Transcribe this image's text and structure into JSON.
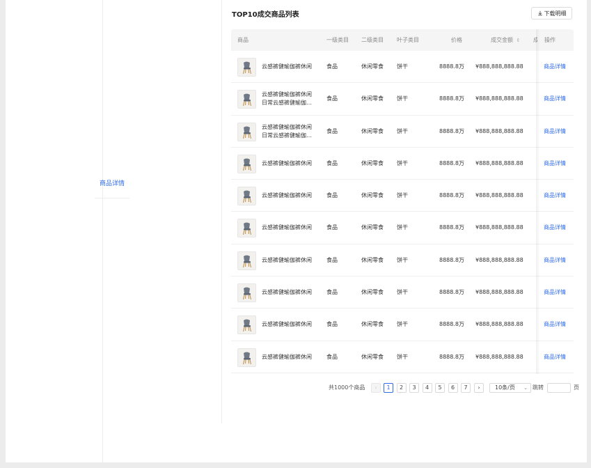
{
  "ghost": {
    "link_label": "商品详情"
  },
  "panel": {
    "title": "TOP10成交商品列表",
    "download_label": "下载明细"
  },
  "table": {
    "columns": {
      "product": "商品",
      "cat1": "一级类目",
      "cat2": "二级类目",
      "leaf": "叶子类目",
      "price": "价格",
      "amount": "成交金额",
      "extra": "成",
      "action": "操作"
    },
    "rows": [
      {
        "name": "云感裤健瑜伽裤休闲",
        "cat1": "食品",
        "cat2": "休闲零食",
        "leaf": "饼干",
        "price": "8888.8万",
        "amount": "¥888,888,888.88",
        "action": "商品详情"
      },
      {
        "name": "云感裤健瑜伽裤休闲日常云感裤健瑜伽裤休闲",
        "cat1": "食品",
        "cat2": "休闲零食",
        "leaf": "饼干",
        "price": "8888.8万",
        "amount": "¥888,888,888.88",
        "action": "商品详情"
      },
      {
        "name": "云感裤健瑜伽裤休闲日常云感裤健瑜伽裤休闲",
        "cat1": "食品",
        "cat2": "休闲零食",
        "leaf": "饼干",
        "price": "8888.8万",
        "amount": "¥888,888,888.88",
        "action": "商品详情"
      },
      {
        "name": "云感裤健瑜伽裤休闲",
        "cat1": "食品",
        "cat2": "休闲零食",
        "leaf": "饼干",
        "price": "8888.8万",
        "amount": "¥888,888,888.88",
        "action": "商品详情"
      },
      {
        "name": "云感裤健瑜伽裤休闲",
        "cat1": "食品",
        "cat2": "休闲零食",
        "leaf": "饼干",
        "price": "8888.8万",
        "amount": "¥888,888,888.88",
        "action": "商品详情"
      },
      {
        "name": "云感裤健瑜伽裤休闲",
        "cat1": "食品",
        "cat2": "休闲零食",
        "leaf": "饼干",
        "price": "8888.8万",
        "amount": "¥888,888,888.88",
        "action": "商品详情"
      },
      {
        "name": "云感裤健瑜伽裤休闲",
        "cat1": "食品",
        "cat2": "休闲零食",
        "leaf": "饼干",
        "price": "8888.8万",
        "amount": "¥888,888,888.88",
        "action": "商品详情"
      },
      {
        "name": "云感裤健瑜伽裤休闲",
        "cat1": "食品",
        "cat2": "休闲零食",
        "leaf": "饼干",
        "price": "8888.8万",
        "amount": "¥888,888,888.88",
        "action": "商品详情"
      },
      {
        "name": "云感裤健瑜伽裤休闲",
        "cat1": "食品",
        "cat2": "休闲零食",
        "leaf": "饼干",
        "price": "8888.8万",
        "amount": "¥888,888,888.88",
        "action": "商品详情"
      },
      {
        "name": "云感裤健瑜伽裤休闲",
        "cat1": "食品",
        "cat2": "休闲零食",
        "leaf": "饼干",
        "price": "8888.8万",
        "amount": "¥888,888,888.88",
        "action": "商品详情"
      }
    ]
  },
  "pagination": {
    "total": "共1000个商品",
    "prev": "‹",
    "next": "›",
    "pages": [
      "1",
      "2",
      "3",
      "4",
      "5",
      "6",
      "7"
    ],
    "current": "1",
    "page_size": "10条/页",
    "jump_label": "跳转",
    "jump_value": "",
    "jump_unit": "页"
  },
  "colors": {
    "accent": "#2e6be6",
    "header_bg": "#f5f5f5",
    "border": "#ededed"
  },
  "icons": {
    "download": "download-icon",
    "sort": "sort-icon",
    "thumbnail": "chair-icon"
  }
}
